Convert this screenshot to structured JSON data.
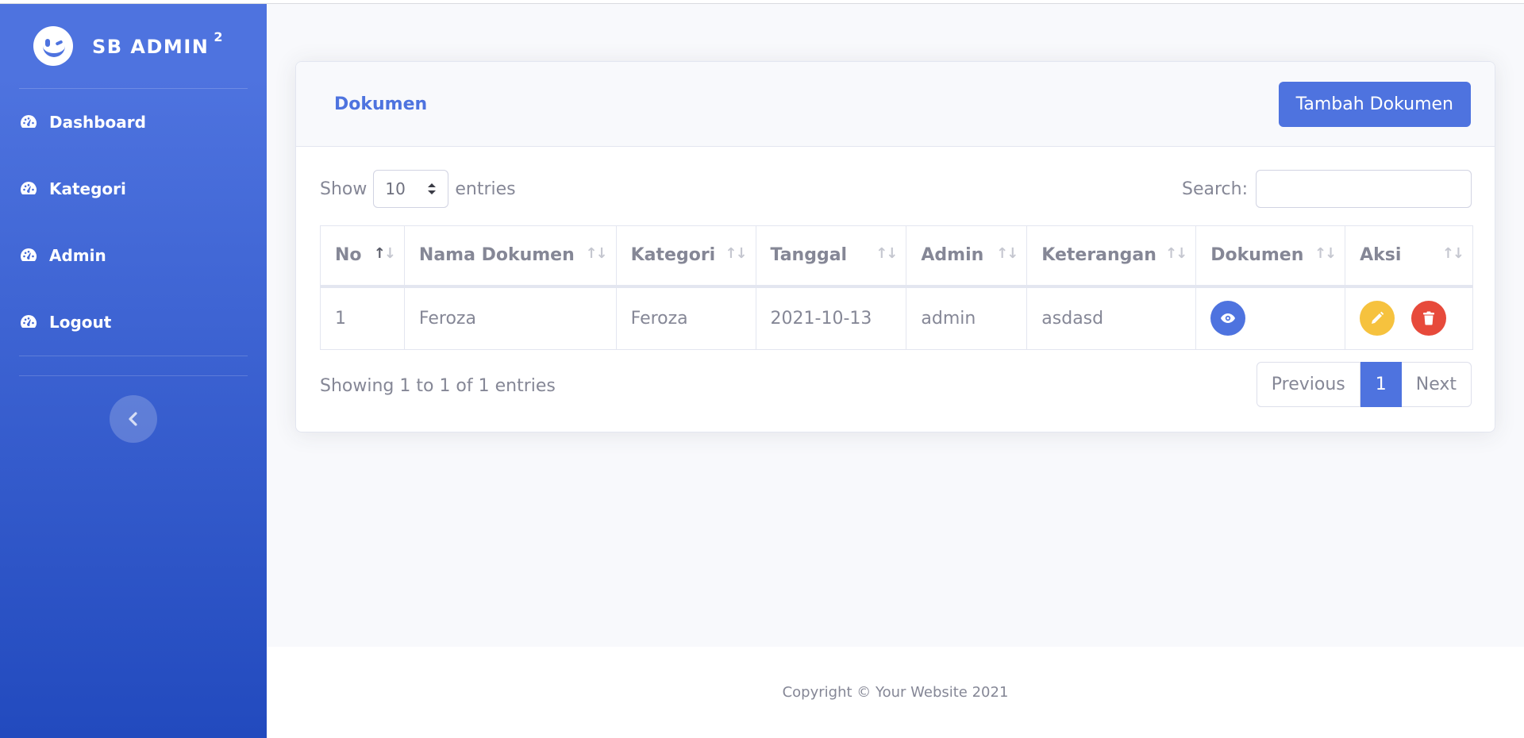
{
  "brand": {
    "name": "SB ADMIN",
    "superscript": "2"
  },
  "sidebar": {
    "items": [
      {
        "label": "Dashboard",
        "icon": "tachometer-icon"
      },
      {
        "label": "Kategori",
        "icon": "tachometer-icon"
      },
      {
        "label": "Admin",
        "icon": "tachometer-icon"
      },
      {
        "label": "Logout",
        "icon": "tachometer-icon"
      }
    ],
    "toggle_icon": "chevron-left-icon"
  },
  "card": {
    "title": "Dokumen",
    "add_button": "Tambah Dokumen"
  },
  "table_controls": {
    "show_label": "Show",
    "entries_value": "10",
    "entries_label": "entries",
    "search_label": "Search:",
    "search_value": ""
  },
  "table": {
    "columns": [
      "No",
      "Nama Dokumen",
      "Kategori",
      "Tanggal",
      "Admin",
      "Keterangan",
      "Dokumen",
      "Aksi"
    ],
    "rows": [
      {
        "no": "1",
        "nama": "Feroza",
        "kategori": "Feroza",
        "tanggal": "2021-10-13",
        "admin": "admin",
        "keterangan": "asdasd"
      }
    ]
  },
  "info_text": "Showing 1 to 1 of 1 entries",
  "pagination": {
    "previous": "Previous",
    "current": "1",
    "next": "Next"
  },
  "footer": {
    "copyright": "Copyright © Your Website 2021"
  },
  "colors": {
    "primary": "#4e73df",
    "warning": "#f6c23e",
    "danger": "#e74a3b",
    "text": "#858796"
  }
}
